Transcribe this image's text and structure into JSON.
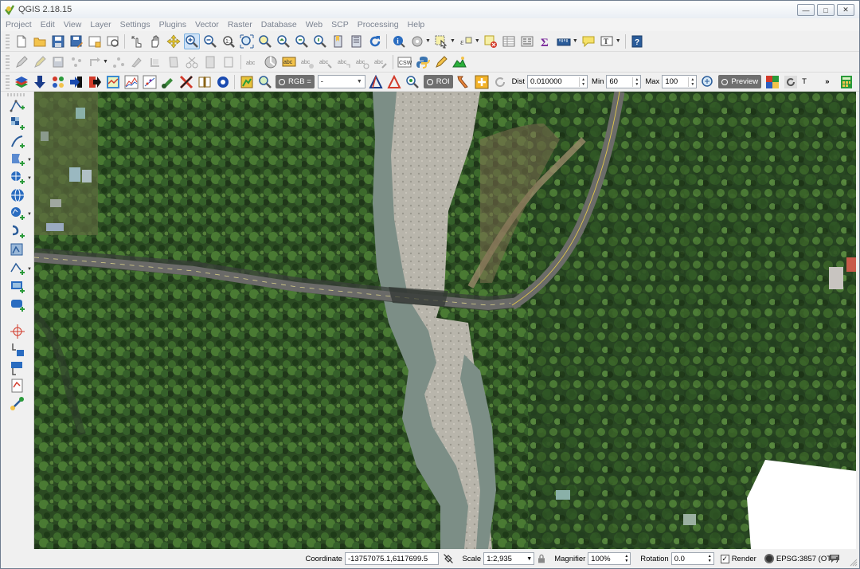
{
  "window": {
    "title": "QGIS 2.18.15",
    "minimize": "—",
    "maximize": "□",
    "close": "✕"
  },
  "menubar": {
    "items": [
      "Project",
      "Edit",
      "View",
      "Layer",
      "Settings",
      "Plugins",
      "Vector",
      "Raster",
      "Database",
      "Web",
      "SCP",
      "Processing",
      "Help"
    ]
  },
  "toolbar3": {
    "rgb_label": "RGB =",
    "rgb_value": "-",
    "roi_label": "ROI",
    "dist_label": "Dist",
    "dist_value": "0.010000",
    "min_label": "Min",
    "min_value": "60",
    "max_label": "Max",
    "max_value": "100",
    "preview_label": "Preview",
    "t_label": "T",
    "overflow": "»"
  },
  "statusbar": {
    "coordinate_label": "Coordinate",
    "coordinate_value": "-13757075.1,6117699.5",
    "scale_label": "Scale",
    "scale_value": "1:2,935",
    "magnifier_label": "Magnifier",
    "magnifier_value": "100%",
    "rotation_label": "Rotation",
    "rotation_value": "0.0",
    "render_label": "Render",
    "render_checked": true,
    "crs_label": "EPSG:3857 (OTF)"
  },
  "icons": {
    "toolbar1": [
      "new-project-icon",
      "open-project-icon",
      "save-project-icon",
      "save-as-icon",
      "new-print-composer-icon",
      "composer-manager-icon",
      "touch-zoom-icon",
      "pan-icon",
      "pan-to-selection-icon",
      "zoom-in-icon",
      "zoom-out-icon",
      "zoom-native-icon",
      "zoom-full-icon",
      "zoom-to-selection-icon",
      "zoom-to-layer-icon",
      "zoom-last-icon",
      "zoom-next-icon",
      "new-bookmark-icon",
      "show-bookmarks-icon",
      "refresh-icon",
      "identify-icon",
      "run-action-icon",
      "select-feature-icon",
      "select-by-value-icon",
      "deselect-icon",
      "attribute-table-icon",
      "field-calculator-icon",
      "statistics-icon",
      "measure-icon",
      "map-tips-icon",
      "text-annotation-icon",
      "help-icon"
    ],
    "toolbar2": [
      "current-edits-icon",
      "toggle-editing-icon",
      "save-edits-icon",
      "add-feature-icon",
      "move-feature-icon",
      "node-tool-icon",
      "delete-selected-icon",
      "cut-features-icon",
      "copy-features-icon",
      "paste-features-icon",
      "label-icon",
      "pin-labels-icon",
      "highlight-labels-icon",
      "move-label-icon",
      "rotate-label-icon",
      "change-label-icon",
      "csw-icon",
      "python-icon",
      "digitize-icon",
      "terrain-icon"
    ],
    "sidebar": [
      "add-vector-layer-icon",
      "add-raster-layer-icon",
      "add-delimited-text-icon",
      "add-spatialite-icon",
      "add-postgis-icon",
      "add-wms-icon",
      "add-wfs-icon",
      "add-wcs-icon",
      "add-mssql-icon",
      "add-oracle-icon",
      "new-shapefile-icon",
      "new-spatialite-icon",
      "new-memory-layer-icon",
      "georeferencer-icon",
      "coordinate-capture-icon",
      "gps-tools-icon",
      "topology-checker-icon",
      "processing-toolbox-icon"
    ]
  },
  "colors": {
    "chrome": "#f0f0f0",
    "forest": "#2b4a22",
    "river": "#8a9a8e",
    "gravel": "#b5b2a8",
    "road": "#6a6a6a"
  }
}
